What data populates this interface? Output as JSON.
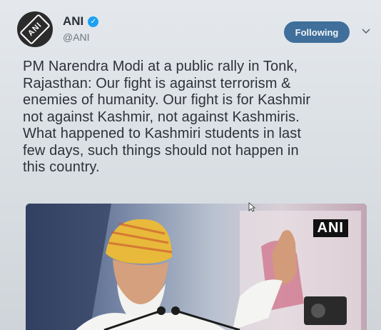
{
  "account": {
    "display_name": "ANI",
    "handle": "@ANI",
    "avatar_text": "ANI",
    "verified_glyph": "✓"
  },
  "actions": {
    "follow_label": "Following",
    "more_icon": "chevron-down-icon"
  },
  "tweet": {
    "text_lines": [
      "PM Narendra Modi at a public rally in Tonk,",
      "Rajasthan: Our fight is against terrorism &",
      "enemies of humanity. Our fight is for Kashmir",
      "not against Kashmir, not against Kashmiris.",
      "What happened to Kashmiri students in last",
      "few days, such things should not happen in",
      "this country."
    ]
  },
  "media": {
    "watermark": "ANI"
  },
  "colors": {
    "follow_button": "#3f6f9a",
    "verified": "#1da1f2",
    "text": "#2e3238"
  }
}
